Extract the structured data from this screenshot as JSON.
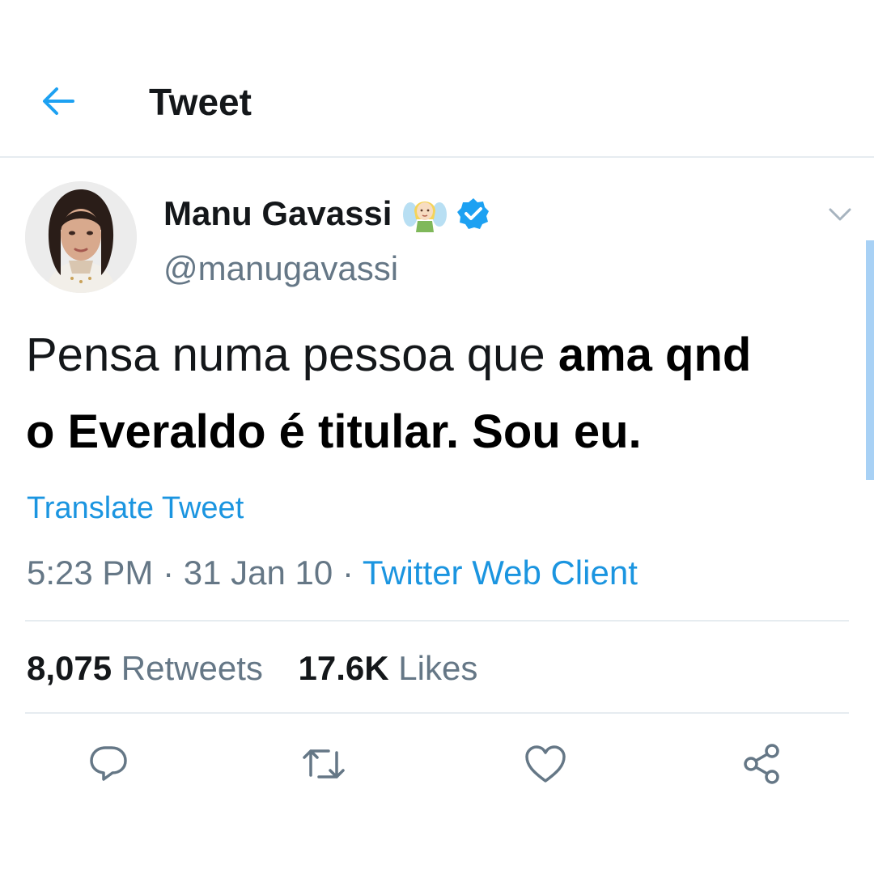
{
  "header": {
    "title": "Tweet",
    "back_icon": "arrow-left-icon"
  },
  "tweet": {
    "author_name": "Manu Gavassi",
    "author_handle": "@manugavassi",
    "name_emoji": "fairy-emoji-icon",
    "verified_icon": "verified-badge-icon",
    "text_line1_regular": "Pensa numa pessoa que",
    "text_line1_edited": "ama qnd",
    "text_line2_edited": "o Everaldo é titular. Sou eu.",
    "translate_label": "Translate Tweet",
    "time": "5:23 PM",
    "date": "31 Jan 10",
    "separator": "·",
    "source": "Twitter Web Client"
  },
  "stats": {
    "retweets_count": "8,075",
    "retweets_label": "Retweets",
    "likes_count": "17.6K",
    "likes_label": "Likes"
  },
  "actions": [
    "reply-icon",
    "retweet-icon",
    "like-icon",
    "share-icon"
  ],
  "colors": {
    "accent": "#1b95e0",
    "secondary_text": "#657786",
    "primary_text": "#14171a",
    "divider": "#e6ecf0",
    "verified": "#1da1f2"
  }
}
